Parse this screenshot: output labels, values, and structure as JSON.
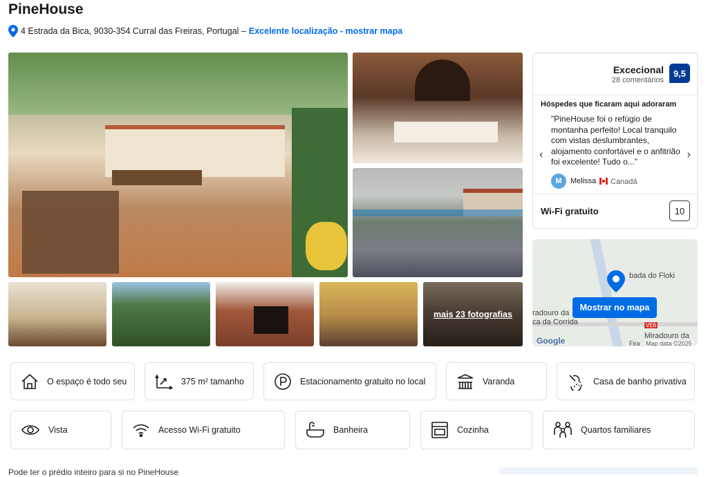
{
  "property": {
    "title": "PineHouse",
    "address": "4 Estrada da Bica, 9030-354 Curral das Freiras, Portugal –",
    "location_link": "Excelente localização - mostrar mapa"
  },
  "gallery": {
    "more_photos": "mais 23 fotografias"
  },
  "review": {
    "label": "Excecional",
    "count": "28 comentários",
    "score": "9,5",
    "guests_heading": "Hóspedes que ficaram aqui adoraram",
    "quote": "\"PineHouse foi o refúgio de montanha perfeito! Local tranquilo com vistas deslumbrantes, alojamento confortável e o anfitrião foi excelente! Tudo o...\"",
    "reviewer_initial": "M",
    "reviewer_name": "Melissa",
    "reviewer_country": "Canadá",
    "wifi_label": "Wi-Fi gratuito",
    "wifi_score": "10"
  },
  "map": {
    "button": "Mostrar no mapa",
    "labels": [
      "bada do Floki",
      "radouro da",
      "ca da Corrida",
      "Miradouro da",
      "Fira",
      "VE6"
    ],
    "google": "Google",
    "date": "Map data ©2025"
  },
  "facilities": [
    {
      "icon": "house-icon",
      "label": "O espaço é todo seu"
    },
    {
      "icon": "size-icon",
      "label": "375 m² tamanho"
    },
    {
      "icon": "parking-icon",
      "label": "Estacionamento gratuito no local"
    },
    {
      "icon": "balcony-icon",
      "label": "Varanda"
    },
    {
      "icon": "shower-icon",
      "label": "Casa de banho privativa"
    },
    {
      "icon": "eye-icon",
      "label": "Vista"
    },
    {
      "icon": "wifi-icon",
      "label": "Acesso Wi-Fi gratuito"
    },
    {
      "icon": "bathtub-icon",
      "label": "Banheira"
    },
    {
      "icon": "oven-icon",
      "label": "Cozinha"
    },
    {
      "icon": "family-icon",
      "label": "Quartos familiares"
    }
  ],
  "description_start": "Pode ter o prédio inteiro para si no PineHouse"
}
